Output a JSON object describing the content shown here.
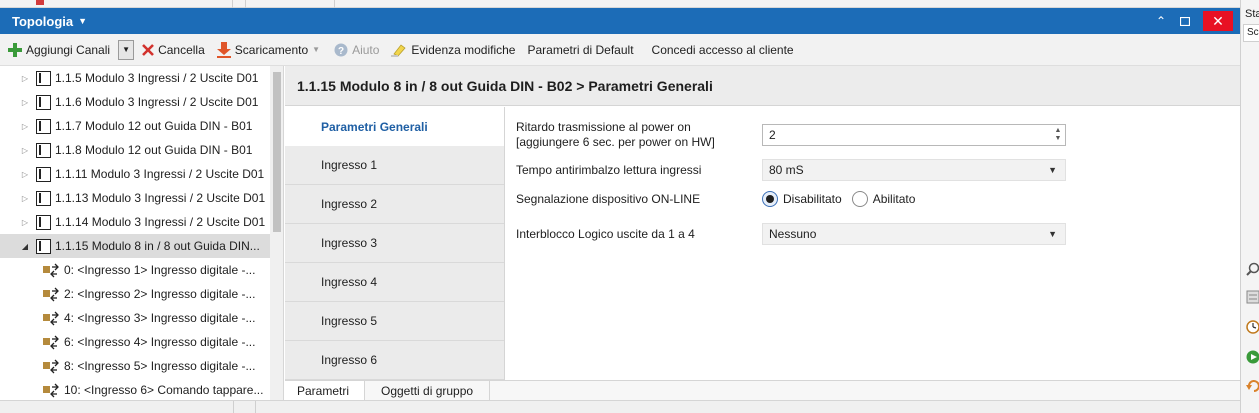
{
  "window": {
    "title": "Topologia"
  },
  "toolbar": {
    "add_channels": "Aggiungi Canali",
    "delete": "Cancella",
    "download": "Scaricamento",
    "help": "Aiuto",
    "highlight": "Evidenza modifiche",
    "default_params": "Parametri di Default",
    "grant_access": "Concedi accesso al cliente"
  },
  "tree": {
    "devices": [
      {
        "label": "1.1.5 Modulo 3 Ingressi / 2 Uscite D01"
      },
      {
        "label": "1.1.6 Modulo 3 Ingressi / 2 Uscite D01"
      },
      {
        "label": "1.1.7 Modulo 12 out Guida DIN - B01"
      },
      {
        "label": "1.1.8 Modulo 12 out Guida DIN - B01"
      },
      {
        "label": "1.1.11 Modulo 3 Ingressi / 2 Uscite D01"
      },
      {
        "label": "1.1.13 Modulo 3 Ingressi / 2 Uscite D01"
      },
      {
        "label": "1.1.14 Modulo 3 Ingressi / 2 Uscite D01"
      },
      {
        "label": "1.1.15 Modulo 8 in / 8 out Guida DIN..."
      }
    ],
    "objects": [
      {
        "label": "0: <Ingresso 1> Ingresso digitale -..."
      },
      {
        "label": "2: <Ingresso 2> Ingresso digitale -..."
      },
      {
        "label": "4: <Ingresso 3> Ingresso digitale -..."
      },
      {
        "label": "6: <Ingresso 4> Ingresso digitale -..."
      },
      {
        "label": "8: <Ingresso 5> Ingresso digitale -..."
      },
      {
        "label": "10: <Ingresso 6> Comando tappare..."
      }
    ]
  },
  "main": {
    "header": "1.1.15 Modulo 8 in / 8 out Guida DIN - B02 > Parametri Generali",
    "nav": [
      {
        "label": "Parametri Generali"
      },
      {
        "label": "Ingresso 1"
      },
      {
        "label": "Ingresso 2"
      },
      {
        "label": "Ingresso 3"
      },
      {
        "label": "Ingresso 4"
      },
      {
        "label": "Ingresso 5"
      },
      {
        "label": "Ingresso 6"
      }
    ],
    "params": {
      "delay": {
        "label_line1": "Ritardo trasmissione al power on",
        "label_line2": "[aggiungere 6 sec. per power on HW]",
        "value": "2"
      },
      "debounce": {
        "label": "Tempo antirimbalzo lettura ingressi",
        "value": "80 mS"
      },
      "online": {
        "label": "Segnalazione dispositivo ON-LINE",
        "option_off": "Disabilitato",
        "option_on": "Abilitato",
        "selected": "Disabilitato"
      },
      "interlock": {
        "label": "Interblocco Logico uscite da 1 a 4",
        "value": "Nessuno"
      }
    },
    "bottom_tabs": {
      "params": "Parametri",
      "group_objects": "Oggetti di gruppo"
    }
  },
  "right_panel": {
    "label_top": "Sta",
    "label_field": "Sc"
  },
  "colors": {
    "titlebar": "#1c6cb7",
    "accent_text": "#1f5fa4",
    "close_button": "#e81123"
  },
  "icons": [
    "add-icon",
    "delete-icon",
    "download-icon",
    "help-icon",
    "highlight-icon",
    "device-icon",
    "group-object-icon"
  ]
}
